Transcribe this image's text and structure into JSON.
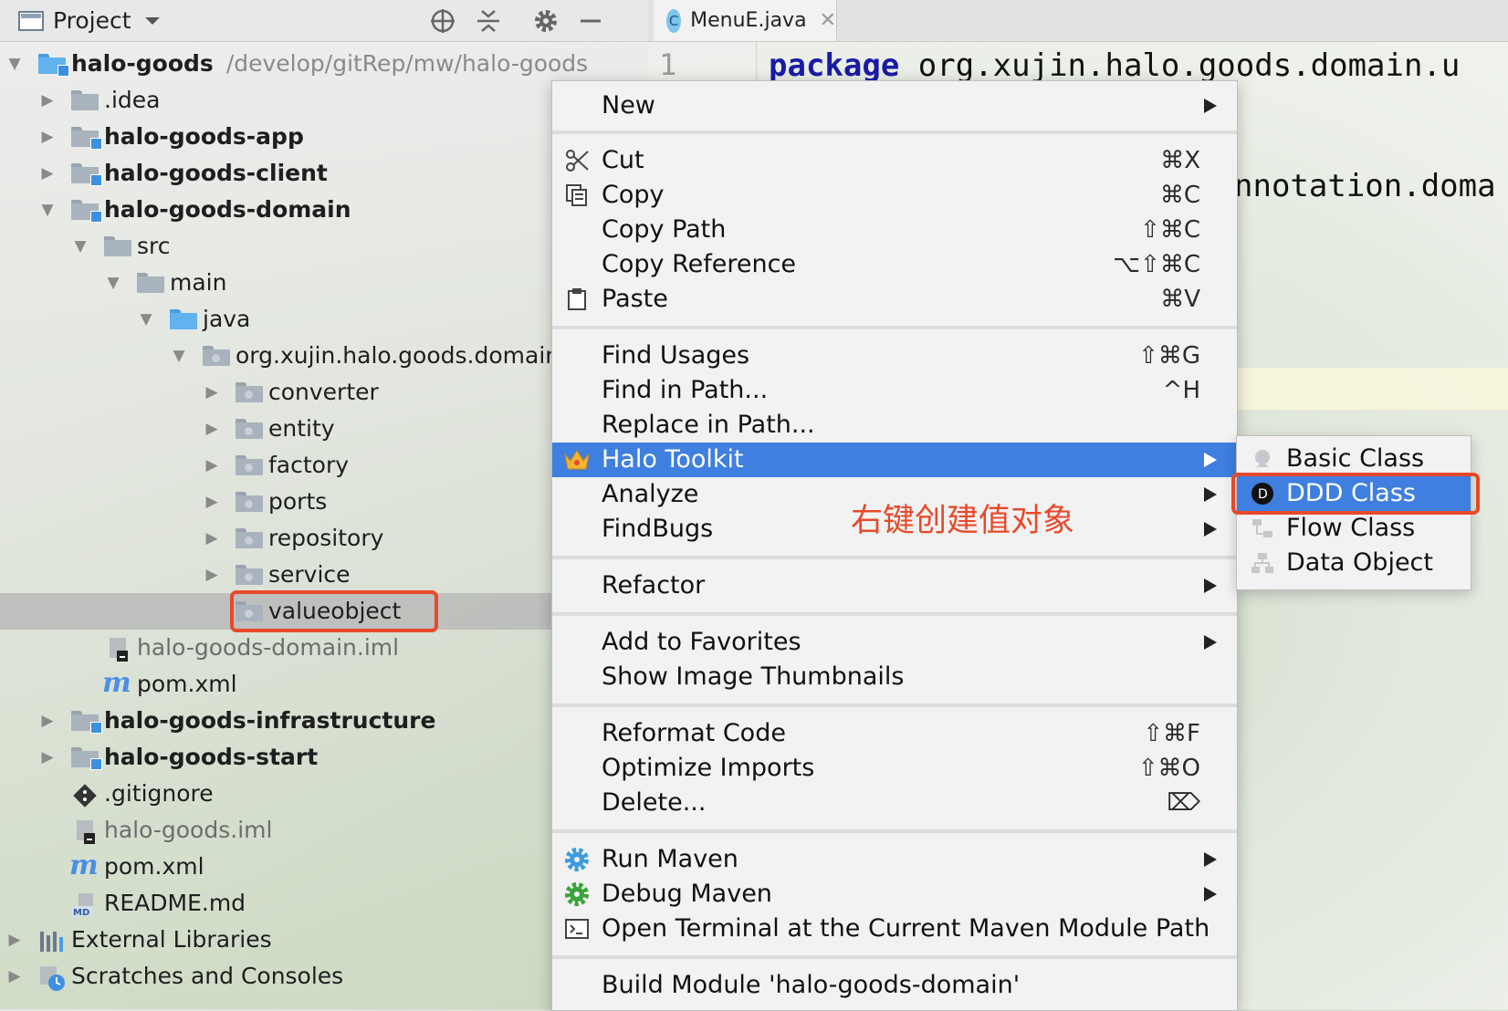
{
  "project_panel": {
    "title": "Project",
    "icons": [
      "locate-icon",
      "collapse-all-icon",
      "gear-icon",
      "minimize-icon"
    ],
    "tree": [
      {
        "label": "halo-goods",
        "hint": "/develop/gitRep/mw/halo-goods"
      },
      {
        "label": ".idea"
      },
      {
        "label": "halo-goods-app"
      },
      {
        "label": "halo-goods-client"
      },
      {
        "label": "halo-goods-domain"
      },
      {
        "label": "src"
      },
      {
        "label": "main"
      },
      {
        "label": "java"
      },
      {
        "label": "org.xujin.halo.goods.domain"
      },
      {
        "label": "converter"
      },
      {
        "label": "entity"
      },
      {
        "label": "factory"
      },
      {
        "label": "ports"
      },
      {
        "label": "repository"
      },
      {
        "label": "service"
      },
      {
        "label": "valueobject"
      },
      {
        "label": "halo-goods-domain.iml"
      },
      {
        "label": "pom.xml"
      },
      {
        "label": "halo-goods-infrastructure"
      },
      {
        "label": "halo-goods-start"
      },
      {
        "label": ".gitignore"
      },
      {
        "label": "halo-goods.iml"
      },
      {
        "label": "pom.xml"
      },
      {
        "label": "README.md"
      },
      {
        "label": "External Libraries"
      },
      {
        "label": "Scratches and Consoles"
      }
    ]
  },
  "editor": {
    "tab": {
      "label": "MenuE.java",
      "badge": "C"
    },
    "line_number": "1",
    "code_line_1_keyword": "package",
    "code_line_1_rest": "org.xujin.halo.goods.domain.u",
    "code_line_2": "nnotation.doma"
  },
  "context_menu": {
    "items": [
      {
        "label": "New"
      },
      {
        "label": "Cut",
        "shortcut": "⌘X"
      },
      {
        "label": "Copy",
        "shortcut": "⌘C"
      },
      {
        "label": "Copy Path",
        "shortcut": "⇧⌘C"
      },
      {
        "label": "Copy Reference",
        "shortcut": "⌥⇧⌘C"
      },
      {
        "label": "Paste",
        "shortcut": "⌘V"
      },
      {
        "label": "Find Usages",
        "shortcut": "⇧⌘G"
      },
      {
        "label": "Find in Path...",
        "shortcut": "^H"
      },
      {
        "label": "Replace in Path..."
      },
      {
        "label": "Halo Toolkit"
      },
      {
        "label": "Analyze"
      },
      {
        "label": "FindBugs"
      },
      {
        "label": "Refactor"
      },
      {
        "label": "Add to Favorites"
      },
      {
        "label": "Show Image Thumbnails"
      },
      {
        "label": "Reformat Code",
        "shortcut": "⇧⌘F"
      },
      {
        "label": "Optimize Imports",
        "shortcut": "⇧⌘O"
      },
      {
        "label": "Delete...",
        "shortcut": "⌦"
      },
      {
        "label": "Run Maven"
      },
      {
        "label": "Debug Maven"
      },
      {
        "label": "Open Terminal at the Current Maven Module Path"
      },
      {
        "label": "Build Module 'halo-goods-domain'"
      }
    ],
    "annotation": "右键创建值对象",
    "highlight_color": "#3f7fe0",
    "annotation_color": "#e8492a"
  },
  "submenu": {
    "items": [
      {
        "label": "Basic Class"
      },
      {
        "label": "DDD Class"
      },
      {
        "label": "Flow Class"
      },
      {
        "label": "Data Object"
      }
    ]
  }
}
